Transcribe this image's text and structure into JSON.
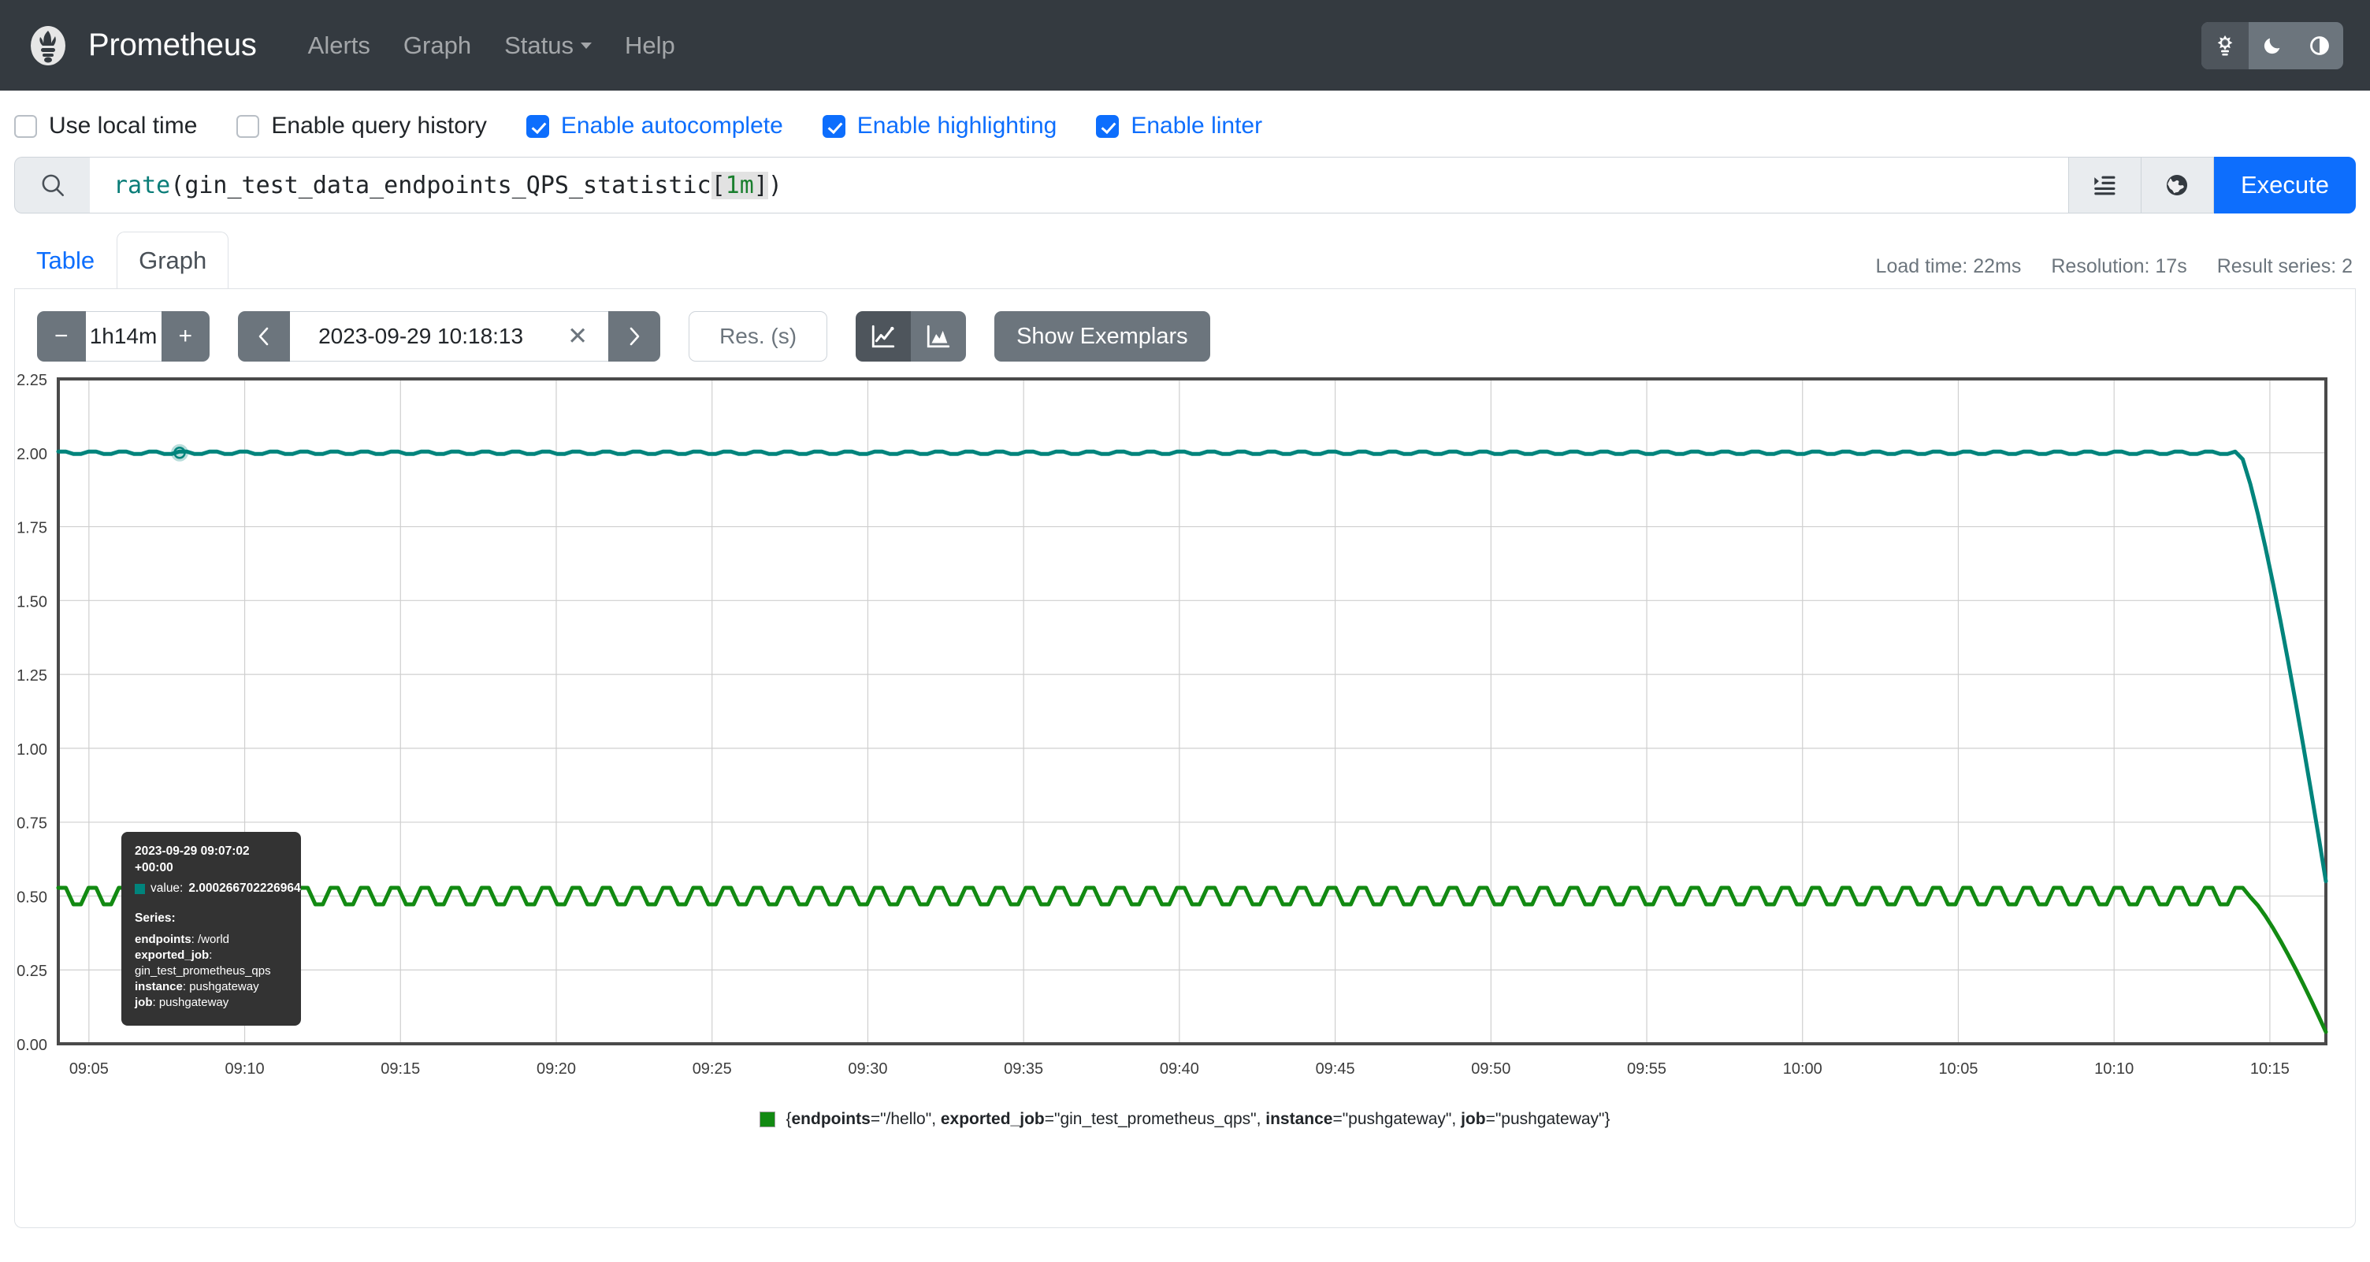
{
  "navbar": {
    "brand": "Prometheus",
    "logo_icon": "prometheus-logo",
    "links": [
      {
        "label": "Alerts",
        "icon": null
      },
      {
        "label": "Graph",
        "icon": null
      },
      {
        "label": "Status",
        "icon": "chevron-down-icon"
      },
      {
        "label": "Help",
        "icon": null
      }
    ],
    "theme_buttons": [
      {
        "name": "light",
        "icon": "sun-icon",
        "active": true
      },
      {
        "name": "dark",
        "icon": "moon-icon",
        "active": false
      },
      {
        "name": "auto",
        "icon": "half-circle-icon",
        "active": false
      }
    ]
  },
  "options": [
    {
      "label": "Use local time",
      "checked": false
    },
    {
      "label": "Enable query history",
      "checked": false
    },
    {
      "label": "Enable autocomplete",
      "checked": true
    },
    {
      "label": "Enable highlighting",
      "checked": true
    },
    {
      "label": "Enable linter",
      "checked": true
    }
  ],
  "query": {
    "search_icon": "search-icon",
    "tokens": {
      "fn": "rate",
      "open_paren": "(",
      "metric": "gin_test_data_endpoints_QPS_statistic",
      "open_bracket": "[",
      "duration": "1m",
      "close_bracket": "]",
      "close_paren": ")"
    },
    "full_text": "rate(gin_test_data_endpoints_QPS_statistic[1m])",
    "format_icon": "format-query-icon",
    "globe_icon": "globe-icon",
    "execute_label": "Execute"
  },
  "tabs": {
    "items": [
      {
        "label": "Table",
        "active": false
      },
      {
        "label": "Graph",
        "active": true
      }
    ],
    "stats": [
      "Load time: 22ms",
      "Resolution: 17s",
      "Result series: 2"
    ]
  },
  "controls": {
    "range_minus": "−",
    "range_value": "1h14m",
    "range_plus": "+",
    "time_prev_icon": "chevron-left-icon",
    "time_value": "2023-09-29 10:18:13",
    "time_clear_icon": "close-icon",
    "time_next_icon": "chevron-right-icon",
    "resolution_placeholder": "Res. (s)",
    "resolution_value": "",
    "chart_type_line_icon": "line-chart-icon",
    "chart_type_stacked_icon": "stacked-area-chart-icon",
    "chart_type_active": "line",
    "show_exemplars_label": "Show Exemplars"
  },
  "tooltip": {
    "timestamp": "2023-09-29 09:07:02 +00:00",
    "value_label": "value:",
    "value": "2.000266702226964",
    "swatch_color": "#00847c",
    "series_heading": "Series:",
    "series": [
      {
        "key": "endpoints",
        "value": "/world"
      },
      {
        "key": "exported_job",
        "value": "gin_test_prometheus_qps"
      },
      {
        "key": "instance",
        "value": "pushgateway"
      },
      {
        "key": "job",
        "value": "pushgateway"
      }
    ]
  },
  "legend": {
    "swatch_color": "#128a12",
    "prefix": "{",
    "entries": [
      {
        "key": "endpoints",
        "value": "\"/hello\""
      },
      {
        "key": "exported_job",
        "value": "\"gin_test_prometheus_qps\""
      },
      {
        "key": "instance",
        "value": "\"pushgateway\""
      },
      {
        "key": "job",
        "value": "\"pushgateway\""
      }
    ],
    "suffix": "}",
    "full_text": "{endpoints=\"/hello\", exported_job=\"gin_test_prometheus_qps\", instance=\"pushgateway\", job=\"pushgateway\"}"
  },
  "chart_data": {
    "type": "line",
    "title": "",
    "xlabel": "",
    "ylabel": "",
    "ylim": [
      0.0,
      2.25
    ],
    "yticks": [
      0.0,
      0.25,
      0.5,
      0.75,
      1.0,
      1.25,
      1.5,
      1.75,
      2.0,
      2.25
    ],
    "ytick_labels": [
      "0.00",
      "0.25",
      "0.50",
      "0.75",
      "1.00",
      "1.25",
      "1.50",
      "1.75",
      "2.00",
      "2.25"
    ],
    "xticks": [
      "09:05",
      "09:10",
      "09:15",
      "09:20",
      "09:25",
      "09:30",
      "09:35",
      "09:40",
      "09:45",
      "09:50",
      "09:55",
      "10:00",
      "10:05",
      "10:10",
      "10:15"
    ],
    "xlim": [
      "09:03:30",
      "10:18:13"
    ],
    "grid": true,
    "legend_position": "bottom",
    "series": [
      {
        "name": "{endpoints=\"/world\", exported_job=\"gin_test_prometheus_qps\", instance=\"pushgateway\", job=\"pushgateway\"}",
        "color": "#00847c",
        "steady_value": 2.0,
        "drop_end_value": 0.55,
        "drop_start_frac": 0.962,
        "noise_amplitude": 0.004
      },
      {
        "name": "{endpoints=\"/hello\", exported_job=\"gin_test_prometheus_qps\", instance=\"pushgateway\", job=\"pushgateway\"}",
        "color": "#128a12",
        "steady_value": 0.5,
        "drop_end_value": 0.04,
        "drop_start_frac": 0.966,
        "noise_amplitude": 0.028
      }
    ],
    "hover_point": {
      "x_frac": 0.0535,
      "value": 2.000266702226964,
      "series_index": 0
    }
  }
}
